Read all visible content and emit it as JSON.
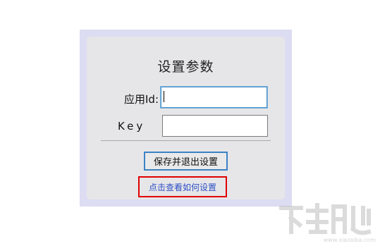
{
  "dialog": {
    "title": "设置参数",
    "fields": {
      "app_id": {
        "label": "应用Id:",
        "value": ""
      },
      "key": {
        "label": "Key",
        "value": ""
      }
    },
    "save_button_label": "保存并退出设置",
    "help_link_label": "点击查看如何设置"
  },
  "watermark": {
    "text": "www.xiazaiba.com"
  },
  "colors": {
    "frame": "#dcdcf2",
    "panel": "#e6e6e9",
    "focus_border": "#4a90c8",
    "button_border": "#3b82c4",
    "highlight_box": "#e00000",
    "link": "#2e4fc4"
  }
}
